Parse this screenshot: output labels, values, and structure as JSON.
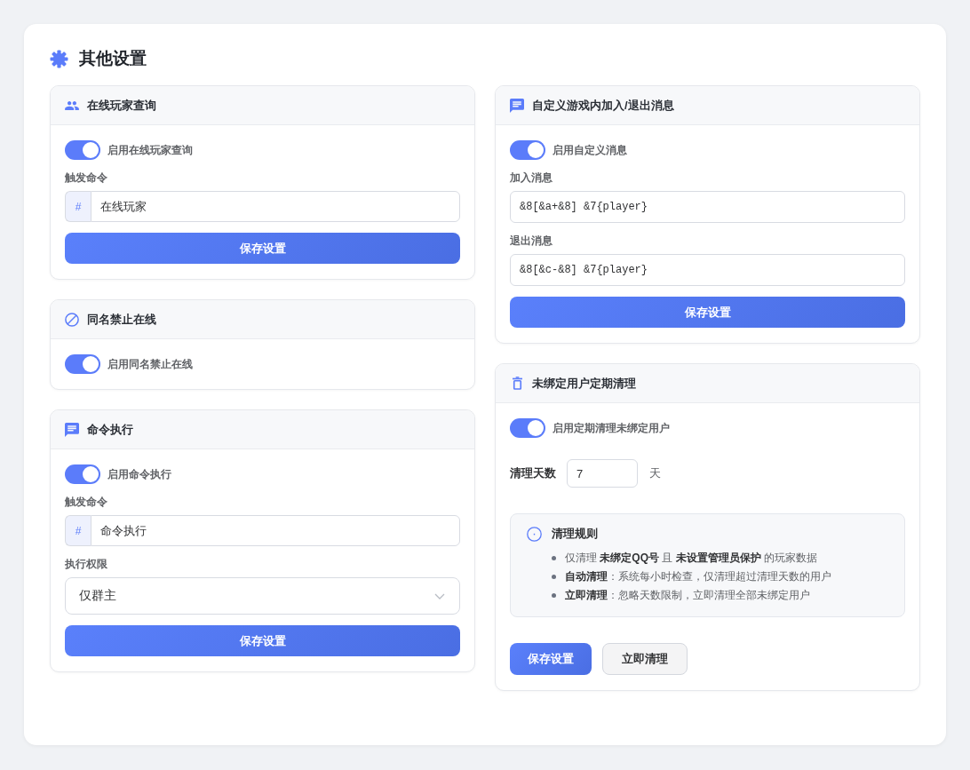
{
  "title": "其他设置",
  "columns": [
    {
      "panels": [
        {
          "title": "在线玩家查询",
          "items": [
            {
              "kind": "toggle",
              "label": "启用在线玩家查询",
              "on": true
            },
            {
              "kind": "prefixed_input",
              "label": "触发命令",
              "prefix": "#",
              "value": "在线玩家"
            },
            {
              "kind": "button",
              "label": "保存设置"
            }
          ]
        },
        {
          "title": "同名禁止在线",
          "items": [
            {
              "kind": "toggle",
              "label": "启用同名禁止在线",
              "on": true
            }
          ]
        },
        {
          "title": "命令执行",
          "items": [
            {
              "kind": "toggle",
              "label": "启用命令执行",
              "on": true
            },
            {
              "kind": "prefixed_input",
              "label": "触发命令",
              "prefix": "#",
              "value": "命令执行"
            },
            {
              "kind": "select",
              "label": "执行权限",
              "value": "仅群主"
            },
            {
              "kind": "button",
              "label": "保存设置"
            }
          ]
        }
      ]
    },
    {
      "panels": [
        {
          "title": "自定义游戏内加入/退出消息",
          "items": [
            {
              "kind": "toggle",
              "label": "启用自定义消息",
              "on": true
            },
            {
              "kind": "input",
              "label": "加入消息",
              "value": "&8[&a+&8] &7{player}"
            },
            {
              "kind": "input",
              "label": "退出消息",
              "value": "&8[&c-&8] &7{player}"
            },
            {
              "kind": "button",
              "label": "保存设置"
            }
          ]
        },
        {
          "title": "未绑定用户定期清理",
          "items": [
            {
              "kind": "toggle",
              "label": "启用定期清理未绑定用户",
              "on": true
            },
            {
              "kind": "number_input",
              "label": "清理天数",
              "value": "7",
              "unit": "天"
            },
            {
              "kind": "info",
              "title": "清理规则",
              "lines": [
                "仅清理 **未绑定QQ号** 且 **未设置管理员保护** 的玩家数据",
                "**自动清理**：系统每小时检查，仅清理超过清理天数的用户",
                "**立即清理**：忽略天数限制，立即清理全部未绑定用户"
              ]
            },
            {
              "kind": "button_row",
              "buttons": [
                {
                  "kind": "primary",
                  "label": "保存设置"
                },
                {
                  "kind": "secondary",
                  "label": "立即清理"
                }
              ]
            }
          ]
        }
      ]
    }
  ]
}
